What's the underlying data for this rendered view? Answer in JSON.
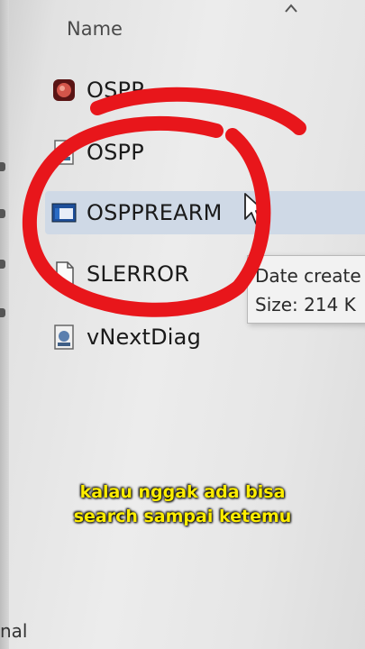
{
  "header": {
    "name_column": "Name"
  },
  "files": [
    {
      "name": "OSPP",
      "icon": "app-icon"
    },
    {
      "name": "OSPP",
      "icon": "script-icon"
    },
    {
      "name": "OSPPREARM",
      "icon": "window-icon",
      "selected": true
    },
    {
      "name": "SLERROR",
      "icon": "file-icon"
    },
    {
      "name": "vNextDiag",
      "icon": "script-icon"
    }
  ],
  "tooltip": {
    "line1": "Date create",
    "line2": "Size: 214 K"
  },
  "caption": {
    "line1": "kalau nggak ada bisa",
    "line2": "search sampai ketemu"
  },
  "bottom_text": "nal",
  "colors": {
    "annotation_circle": "#e8161b",
    "caption_text": "#ffee00",
    "selection": "#cfd9e6"
  }
}
